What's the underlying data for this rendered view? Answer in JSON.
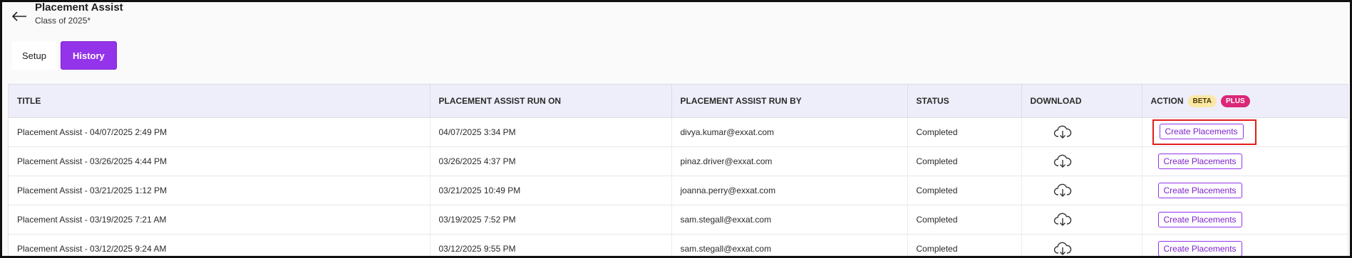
{
  "header": {
    "title": "Placement Assist",
    "subtitle": "Class of 2025*"
  },
  "tabs": [
    {
      "label": "Setup",
      "active": false
    },
    {
      "label": "History",
      "active": true
    }
  ],
  "table": {
    "columns": {
      "title": "TITLE",
      "run_on": "PLACEMENT ASSIST RUN ON",
      "run_by": "PLACEMENT ASSIST RUN BY",
      "status": "STATUS",
      "download": "DOWNLOAD",
      "action": "ACTION",
      "beta_badge": "BETA",
      "plus_badge": "PLUS"
    },
    "rows": [
      {
        "title": "Placement Assist - 04/07/2025 2:49 PM",
        "run_on": "04/07/2025 3:34 PM",
        "run_by": "divya.kumar@exxat.com",
        "status": "Completed",
        "action": "Create Placements"
      },
      {
        "title": "Placement Assist - 03/26/2025 4:44 PM",
        "run_on": "03/26/2025 4:37 PM",
        "run_by": "pinaz.driver@exxat.com",
        "status": "Completed",
        "action": "Create Placements"
      },
      {
        "title": "Placement Assist - 03/21/2025 1:12 PM",
        "run_on": "03/21/2025 10:49 PM",
        "run_by": "joanna.perry@exxat.com",
        "status": "Completed",
        "action": "Create Placements"
      },
      {
        "title": "Placement Assist - 03/19/2025 7:21 AM",
        "run_on": "03/19/2025 7:52 PM",
        "run_by": "sam.stegall@exxat.com",
        "status": "Completed",
        "action": "Create Placements"
      },
      {
        "title": "Placement Assist - 03/12/2025 9:24 AM",
        "run_on": "03/12/2025 9:55 PM",
        "run_by": "sam.stegall@exxat.com",
        "status": "Completed",
        "action": "Create Placements"
      }
    ]
  },
  "icons": {
    "back": "arrow-left-icon",
    "download": "cloud-download-icon"
  },
  "colors": {
    "accent": "#9333ea",
    "header_bg": "#eeeefa",
    "beta_bg": "#fbe7a6",
    "plus_bg": "#db2777",
    "highlight": "#e11d1d"
  }
}
